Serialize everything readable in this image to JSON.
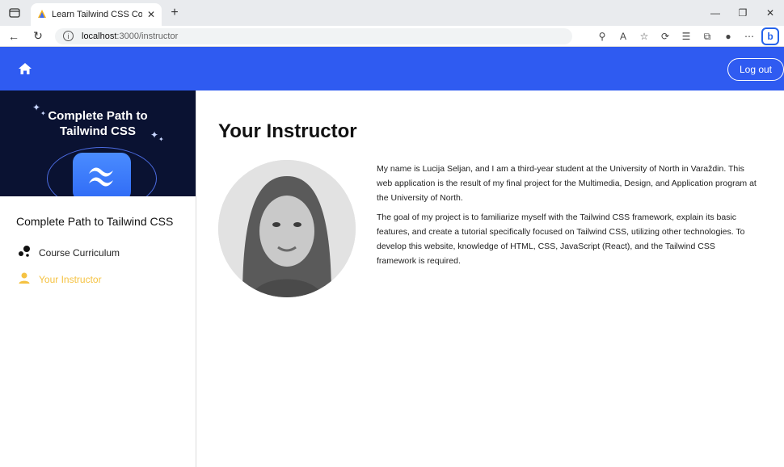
{
  "browser": {
    "tab_title": "Learn Tailwind CSS Course for Be",
    "url_host": "localhost",
    "url_path": ":3000/instructor"
  },
  "header": {
    "logout_label": "Log out"
  },
  "sidebar": {
    "banner_title_line1": "Complete Path to",
    "banner_title_line2": "Tailwind CSS",
    "course_title": "Complete Path to Tailwind CSS",
    "items": [
      {
        "label": "Course Curriculum"
      },
      {
        "label": "Your Instructor"
      }
    ]
  },
  "main": {
    "title": "Your Instructor",
    "paragraphs": [
      "My name is Lucija Seljan, and I am a third-year student at the University of North in Varaždin. This web application is the result of my final project for the Multimedia, Design, and Application program at the University of North.",
      "The goal of my project is to familiarize myself with the Tailwind CSS framework, explain its basic features, and create a tutorial specifically focused on Tailwind CSS, utilizing other technologies. To develop this website, knowledge of HTML, CSS, JavaScript (React), and the Tailwind CSS framework is required."
    ]
  },
  "colors": {
    "header_blue": "#2f5bf1",
    "active_item": "#f5c242",
    "banner_bg": "#0a1232"
  }
}
